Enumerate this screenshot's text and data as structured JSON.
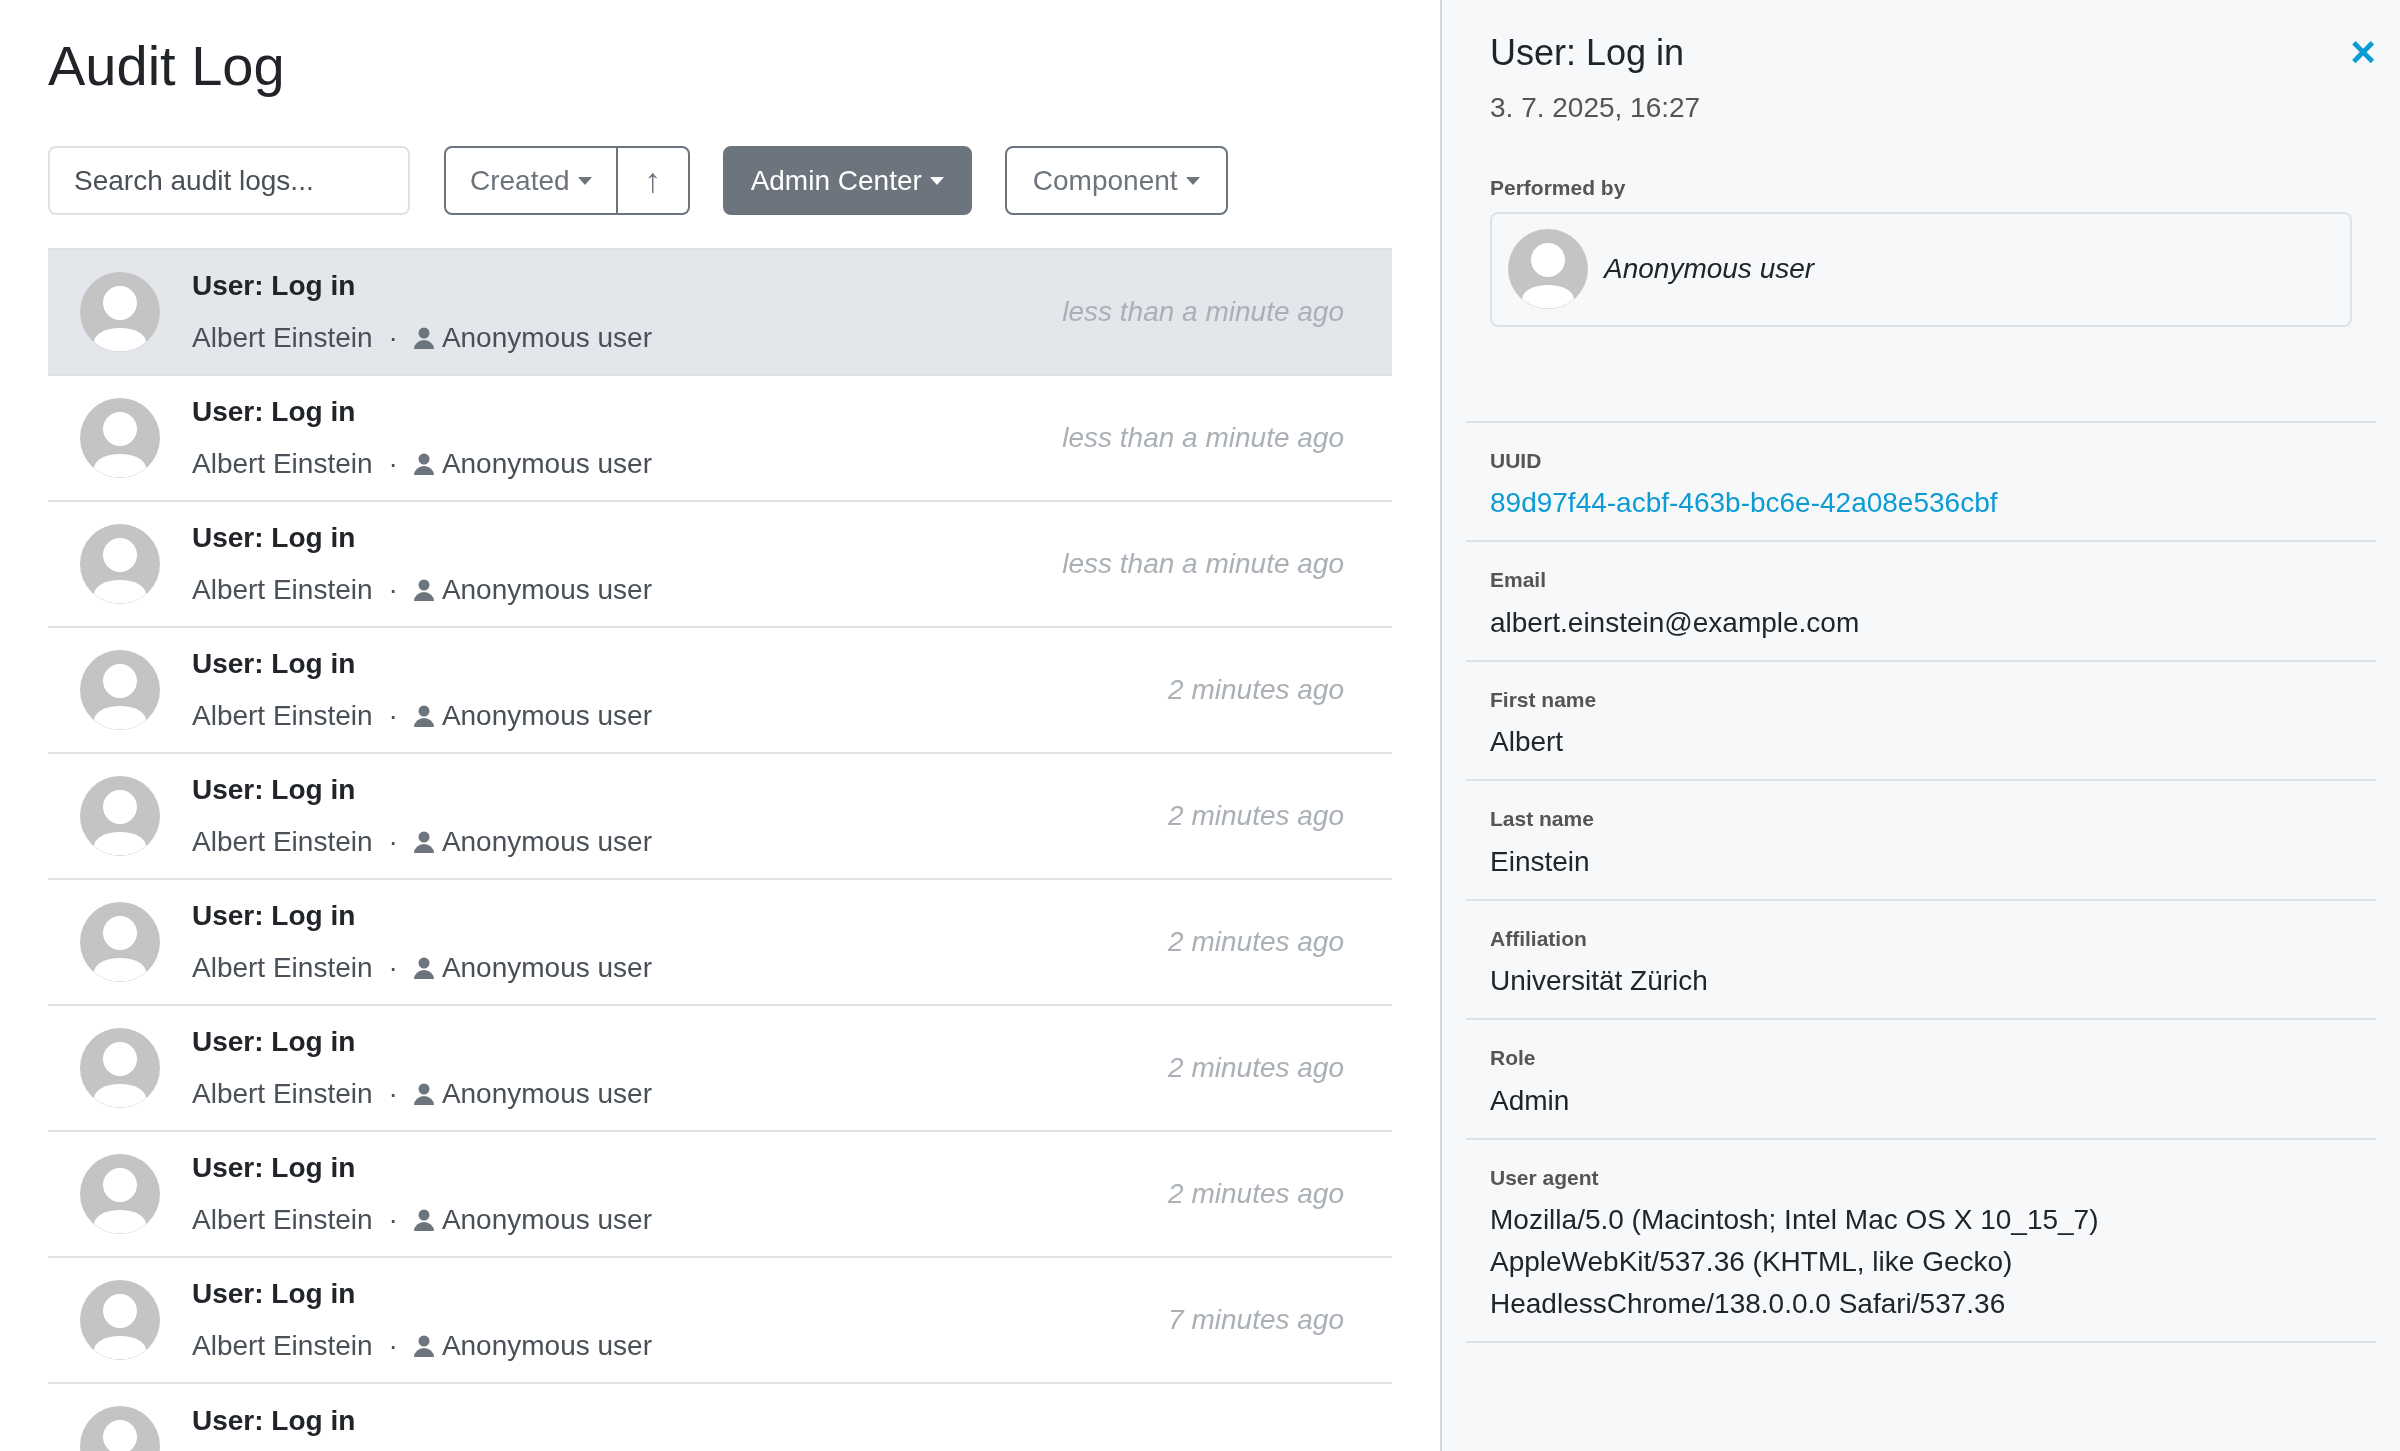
{
  "page": {
    "title": "Audit Log"
  },
  "toolbar": {
    "search": {
      "placeholder": "Search audit logs..."
    },
    "sort": {
      "label": "Created",
      "direction": "↑"
    },
    "filters": [
      {
        "label": "Admin Center",
        "active": true
      },
      {
        "label": "Component",
        "active": false
      }
    ]
  },
  "entries": [
    {
      "title": "User: Log in",
      "user": "Albert Einstein",
      "separator": "·",
      "actor": "Anonymous user",
      "time": "less than a minute ago",
      "selected": true
    },
    {
      "title": "User: Log in",
      "user": "Albert Einstein",
      "separator": "·",
      "actor": "Anonymous user",
      "time": "less than a minute ago",
      "selected": false
    },
    {
      "title": "User: Log in",
      "user": "Albert Einstein",
      "separator": "·",
      "actor": "Anonymous user",
      "time": "less than a minute ago",
      "selected": false
    },
    {
      "title": "User: Log in",
      "user": "Albert Einstein",
      "separator": "·",
      "actor": "Anonymous user",
      "time": "2 minutes ago",
      "selected": false
    },
    {
      "title": "User: Log in",
      "user": "Albert Einstein",
      "separator": "·",
      "actor": "Anonymous user",
      "time": "2 minutes ago",
      "selected": false
    },
    {
      "title": "User: Log in",
      "user": "Albert Einstein",
      "separator": "·",
      "actor": "Anonymous user",
      "time": "2 minutes ago",
      "selected": false
    },
    {
      "title": "User: Log in",
      "user": "Albert Einstein",
      "separator": "·",
      "actor": "Anonymous user",
      "time": "2 minutes ago",
      "selected": false
    },
    {
      "title": "User: Log in",
      "user": "Albert Einstein",
      "separator": "·",
      "actor": "Anonymous user",
      "time": "2 minutes ago",
      "selected": false
    },
    {
      "title": "User: Log in",
      "user": "Albert Einstein",
      "separator": "·",
      "actor": "Anonymous user",
      "time": "7 minutes ago",
      "selected": false
    },
    {
      "title": "User: Log in",
      "selected": false
    }
  ],
  "detail": {
    "title": "User: Log in",
    "date": "3. 7. 2025, 16:27",
    "close": "×",
    "performed_by": {
      "label": "Performed by",
      "name": "Anonymous user"
    },
    "fields": [
      {
        "label": "UUID",
        "value": "89d97f44-acbf-463b-bc6e-42a08e536cbf",
        "kind": "link"
      },
      {
        "label": "Email",
        "value": "albert.einstein@example.com",
        "kind": "text"
      },
      {
        "label": "First name",
        "value": "Albert",
        "kind": "text"
      },
      {
        "label": "Last name",
        "value": "Einstein",
        "kind": "text"
      },
      {
        "label": "Affiliation",
        "value": "Universität Zürich",
        "kind": "text"
      },
      {
        "label": "Role",
        "value": "Admin",
        "kind": "text"
      },
      {
        "label": "User agent",
        "value": "Mozilla/5.0 (Macintosh; Intel Mac OS X 10_15_7) AppleWebKit/537.36 (KHTML, like Gecko) HeadlessChrome/138.0.0.0 Safari/537.36",
        "kind": "text"
      }
    ]
  }
}
